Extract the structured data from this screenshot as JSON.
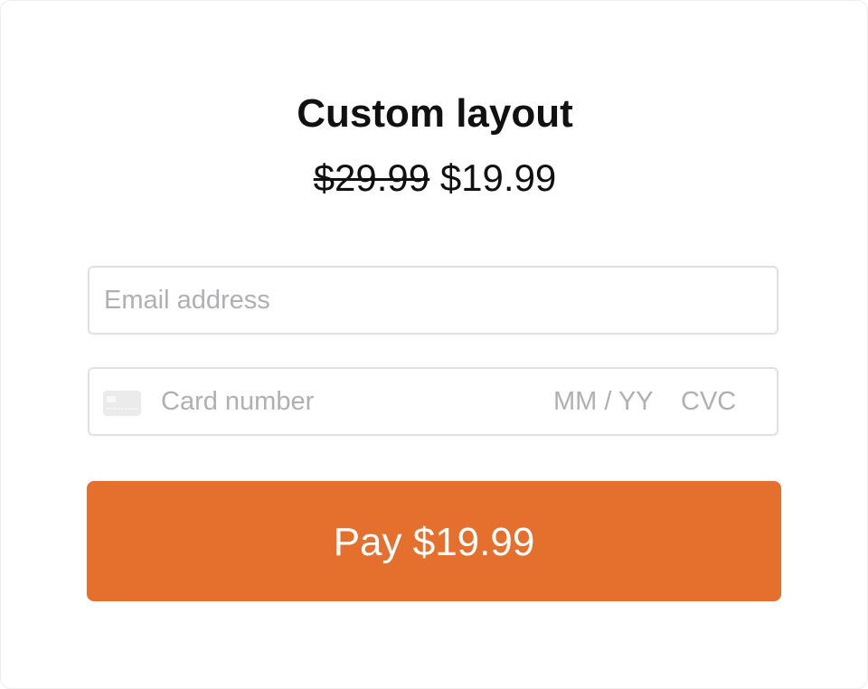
{
  "product": {
    "title": "Custom layout",
    "original_price": "$29.99",
    "sale_price": "$19.99"
  },
  "form": {
    "email_placeholder": "Email address",
    "card_number_placeholder": "Card number",
    "expiry_placeholder": "MM / YY",
    "cvc_placeholder": "CVC"
  },
  "pay_button": {
    "label": "Pay $19.99"
  },
  "colors": {
    "accent": "#e5702e",
    "placeholder": "#b1aeb6",
    "text": "#111111",
    "field_border": "#e1e1e1"
  },
  "icons": {
    "card": "credit-card-icon"
  }
}
